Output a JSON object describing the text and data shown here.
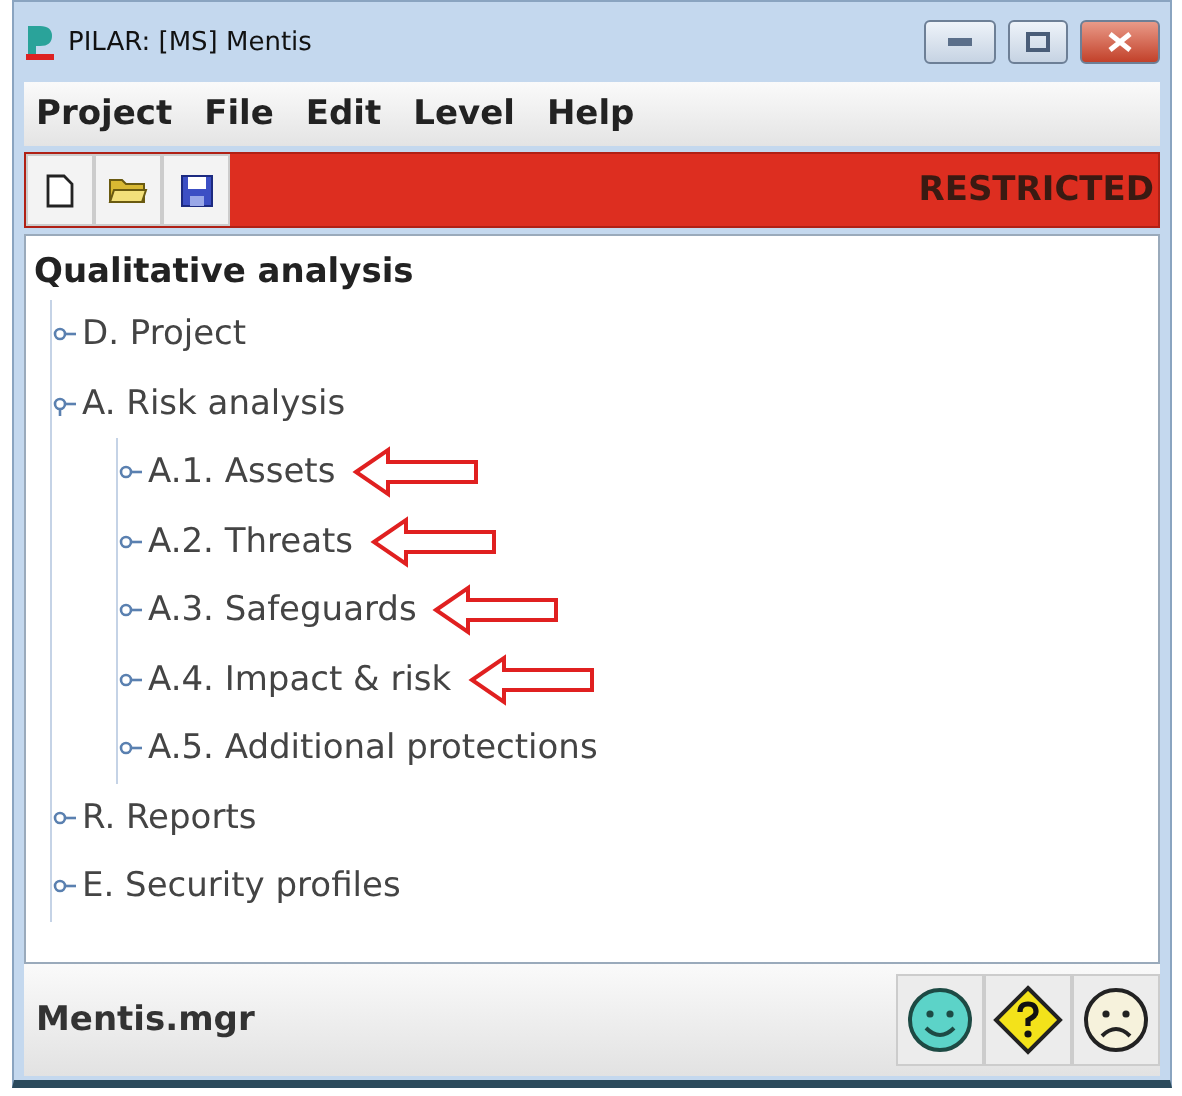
{
  "window": {
    "title": "PILAR: [MS] Mentis"
  },
  "menu": [
    "Project",
    "File",
    "Edit",
    "Level",
    "Help"
  ],
  "toolbar": {
    "buttons": [
      {
        "kind": "new"
      },
      {
        "kind": "open"
      },
      {
        "kind": "save"
      }
    ],
    "badge": "RESTRICTED"
  },
  "tree": {
    "title": "Qualitative analysis",
    "items": [
      {
        "label": "D. Project",
        "expanded": false,
        "marked": false
      },
      {
        "label": "A. Risk analysis",
        "expanded": true,
        "marked": false,
        "children": [
          {
            "label": "A.1. Assets",
            "expanded": false,
            "marked": true
          },
          {
            "label": "A.2. Threats",
            "expanded": false,
            "marked": true
          },
          {
            "label": "A.3. Safeguards",
            "expanded": false,
            "marked": true
          },
          {
            "label": "A.4. Impact & risk",
            "expanded": false,
            "marked": true
          },
          {
            "label": "A.5. Additional protections",
            "expanded": false,
            "marked": false
          }
        ]
      },
      {
        "label": "R. Reports",
        "expanded": false,
        "marked": false
      },
      {
        "label": "E. Security profiles",
        "expanded": false,
        "marked": false
      }
    ]
  },
  "status_bar": {
    "file": "Mentis.mgr",
    "buttons": [
      {
        "kind": "happy"
      },
      {
        "kind": "unknown"
      },
      {
        "kind": "sad"
      }
    ]
  }
}
